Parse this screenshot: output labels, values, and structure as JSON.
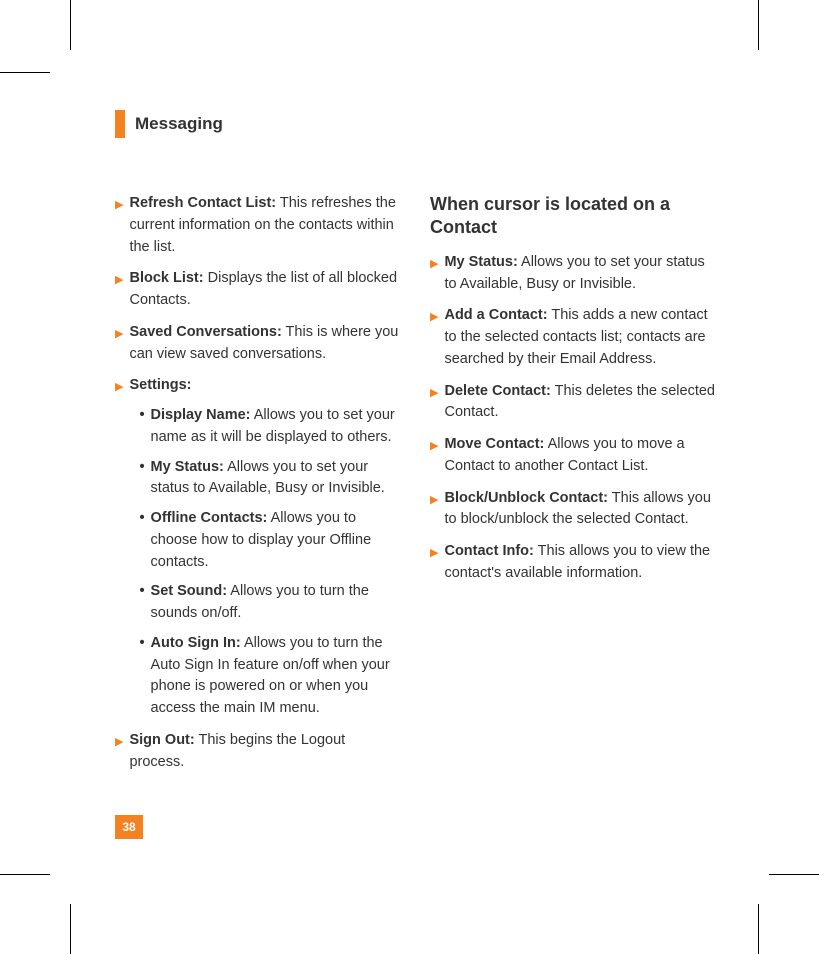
{
  "header": {
    "title": "Messaging"
  },
  "left_column": {
    "items": [
      {
        "label": "Refresh Contact List:",
        "desc": " This refreshes the current information on the contacts within the list."
      },
      {
        "label": "Block List:",
        "desc": " Displays the list of all blocked Contacts."
      },
      {
        "label": "Saved Conversations:",
        "desc": " This is where you can view saved conversations."
      },
      {
        "label": "Settings:",
        "desc": "",
        "sub": [
          {
            "label": "Display Name:",
            "desc": " Allows you to set your name as it will be displayed to others."
          },
          {
            "label": "My Status:",
            "desc": " Allows you to set your status to Available, Busy or Invisible."
          },
          {
            "label": "Offline Contacts:",
            "desc": " Allows you to choose how to display your Offline contacts."
          },
          {
            "label": "Set Sound:",
            "desc": " Allows you to turn the sounds on/off."
          },
          {
            "label": "Auto Sign In:",
            "desc": " Allows you to turn the Auto Sign In feature on/off when your phone is powered on or when you access the main IM menu."
          }
        ]
      },
      {
        "label": "Sign Out:",
        "desc": " This begins the Logout process."
      }
    ]
  },
  "right_column": {
    "heading": "When cursor is located on a Contact",
    "items": [
      {
        "label": "My Status:",
        "desc": " Allows you to set your status to Available, Busy or Invisible."
      },
      {
        "label": "Add a Contact:",
        "desc": " This adds a new contact to the selected contacts list; contacts are searched by their Email Address."
      },
      {
        "label": "Delete Contact:",
        "desc": " This deletes the selected Contact."
      },
      {
        "label": "Move Contact:",
        "desc": " Allows you to move a Contact to another Contact List."
      },
      {
        "label": "Block/Unblock Contact:",
        "desc": " This allows you to block/unblock the selected Contact."
      },
      {
        "label": "Contact Info:",
        "desc": " This allows you to view the contact's available information."
      }
    ]
  },
  "page_number": "38"
}
